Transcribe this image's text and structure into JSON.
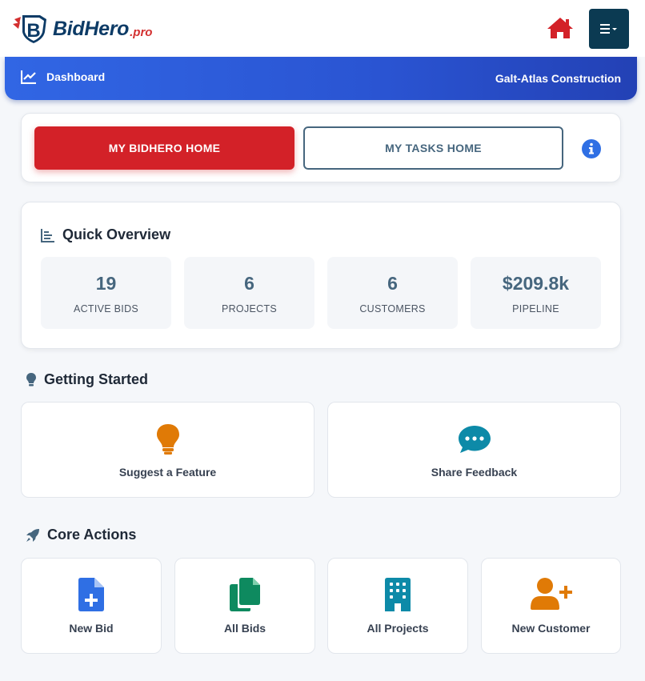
{
  "header": {
    "logo_text": "BidHero",
    "logo_suffix": ".pro",
    "home_icon": "home-icon",
    "menu_icon": "menu-icon",
    "accent_color": "#d32128"
  },
  "navbar": {
    "dashboard_label": "Dashboard",
    "company": "Galt-Atlas Construction"
  },
  "toggle": {
    "primary_label": "MY BIDHERO HOME",
    "secondary_label": "MY TASKS HOME"
  },
  "overview": {
    "title": "Quick Overview",
    "stats": [
      {
        "value": "19",
        "label": "ACTIVE BIDS"
      },
      {
        "value": "6",
        "label": "PROJECTS"
      },
      {
        "value": "6",
        "label": "CUSTOMERS"
      },
      {
        "value": "$209.8k",
        "label": "PIPELINE"
      }
    ]
  },
  "getting_started": {
    "title": "Getting Started",
    "items": [
      {
        "label": "Suggest a Feature",
        "icon": "lightbulb-icon"
      },
      {
        "label": "Share Feedback",
        "icon": "chat-icon"
      }
    ]
  },
  "core_actions": {
    "title": "Core Actions",
    "items": [
      {
        "label": "New Bid",
        "icon": "file-plus-icon"
      },
      {
        "label": "All Bids",
        "icon": "copy-icon"
      },
      {
        "label": "All Projects",
        "icon": "building-icon"
      },
      {
        "label": "New Customer",
        "icon": "user-plus-icon"
      }
    ]
  }
}
